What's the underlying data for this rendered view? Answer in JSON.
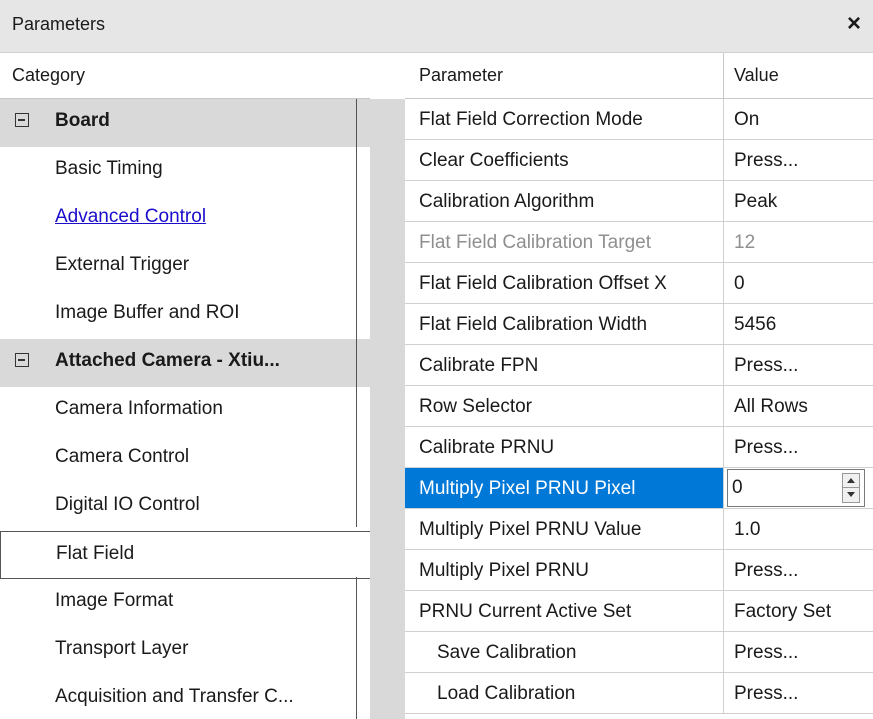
{
  "window": {
    "title": "Parameters",
    "close_glyph": "×"
  },
  "headers": {
    "category": "Category",
    "parameter": "Parameter",
    "value": "Value"
  },
  "categories": [
    {
      "label": "Board",
      "type": "group"
    },
    {
      "label": "Basic Timing",
      "type": "item"
    },
    {
      "label": "Advanced Control",
      "type": "link"
    },
    {
      "label": "External Trigger",
      "type": "item"
    },
    {
      "label": "Image Buffer and ROI",
      "type": "item"
    },
    {
      "label": "Attached Camera - Xtiu...",
      "type": "group"
    },
    {
      "label": "Camera Information",
      "type": "item"
    },
    {
      "label": "Camera Control",
      "type": "item"
    },
    {
      "label": "Digital IO Control",
      "type": "item"
    },
    {
      "label": "Flat Field",
      "type": "selected"
    },
    {
      "label": "Image Format",
      "type": "item"
    },
    {
      "label": "Transport Layer",
      "type": "item"
    },
    {
      "label": "Acquisition and Transfer C...",
      "type": "item"
    }
  ],
  "parameters": [
    {
      "name": "Flat Field Correction Mode",
      "value": "On"
    },
    {
      "name": "Clear Coefficients",
      "value": "Press..."
    },
    {
      "name": "Calibration Algorithm",
      "value": "Peak"
    },
    {
      "name": "Flat Field Calibration Target",
      "value": "12",
      "state": "disabled"
    },
    {
      "name": "Flat Field Calibration Offset X",
      "value": "0"
    },
    {
      "name": "Flat Field Calibration Width",
      "value": "5456"
    },
    {
      "name": "Calibrate FPN",
      "value": "Press..."
    },
    {
      "name": "Row Selector",
      "value": "All Rows"
    },
    {
      "name": "Calibrate PRNU",
      "value": "Press..."
    },
    {
      "name": "Multiply Pixel PRNU Pixel",
      "value": "0",
      "state": "selected"
    },
    {
      "name": "Multiply Pixel PRNU Value",
      "value": "1.0"
    },
    {
      "name": "Multiply Pixel PRNU",
      "value": "Press..."
    },
    {
      "name": "PRNU Current Active Set",
      "value": "Factory Set"
    },
    {
      "name": "Save Calibration",
      "value": "Press...",
      "state": "indent"
    },
    {
      "name": "Load Calibration",
      "value": "Press...",
      "state": "indent"
    }
  ],
  "colors": {
    "selection": "#0078d7",
    "group_bg": "#d9d9d9",
    "link": "#1a0dcc",
    "disabled_text": "#8f8f8f"
  }
}
